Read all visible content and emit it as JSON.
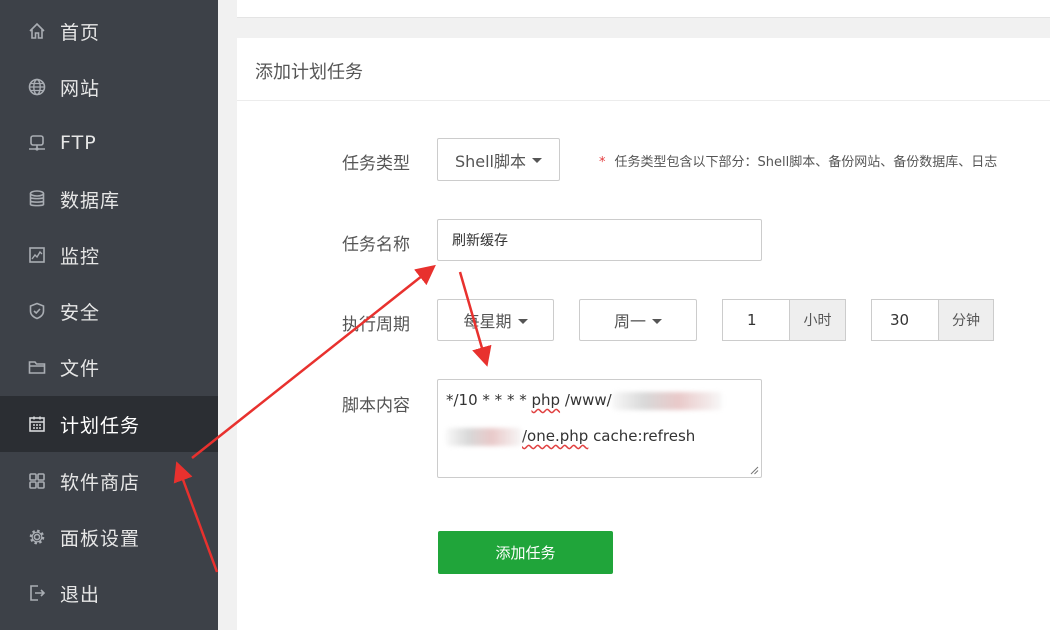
{
  "sidebar": {
    "items": [
      {
        "label": "首页",
        "icon": "home-icon"
      },
      {
        "label": "网站",
        "icon": "globe-icon"
      },
      {
        "label": "FTP",
        "icon": "ftp-server-icon"
      },
      {
        "label": "数据库",
        "icon": "database-icon"
      },
      {
        "label": "监控",
        "icon": "monitor-chart-icon"
      },
      {
        "label": "安全",
        "icon": "shield-icon"
      },
      {
        "label": "文件",
        "icon": "folder-icon"
      },
      {
        "label": "计划任务",
        "icon": "calendar-icon",
        "active": true
      },
      {
        "label": "软件商店",
        "icon": "app-grid-icon"
      },
      {
        "label": "面板设置",
        "icon": "gear-icon"
      },
      {
        "label": "退出",
        "icon": "logout-icon"
      }
    ]
  },
  "panel": {
    "title": "添加计划任务",
    "task_type": {
      "label": "任务类型",
      "value": "Shell脚本",
      "hint_star": "*",
      "hint": "任务类型包含以下部分：Shell脚本、备份网站、备份数据库、日志"
    },
    "task_name": {
      "label": "任务名称",
      "value": "刷新缓存"
    },
    "schedule": {
      "label": "执行周期",
      "period": "每星期",
      "weekday": "周一",
      "hour_value": "1",
      "hour_unit": "小时",
      "minute_value": "30",
      "minute_unit": "分钟"
    },
    "script": {
      "label": "脚本内容",
      "line1_prefix": "*/10 * * * * ",
      "line1_cmd": "php",
      "line1_path": " /www/",
      "line2_file": "/one.php",
      "line2_rest": " cache:refresh"
    },
    "submit_label": "添加任务"
  },
  "colors": {
    "sidebar_bg": "#3d4148",
    "sidebar_active": "#2b2e33",
    "accent_green": "#20a53a",
    "annotation_red": "#e8312e"
  }
}
